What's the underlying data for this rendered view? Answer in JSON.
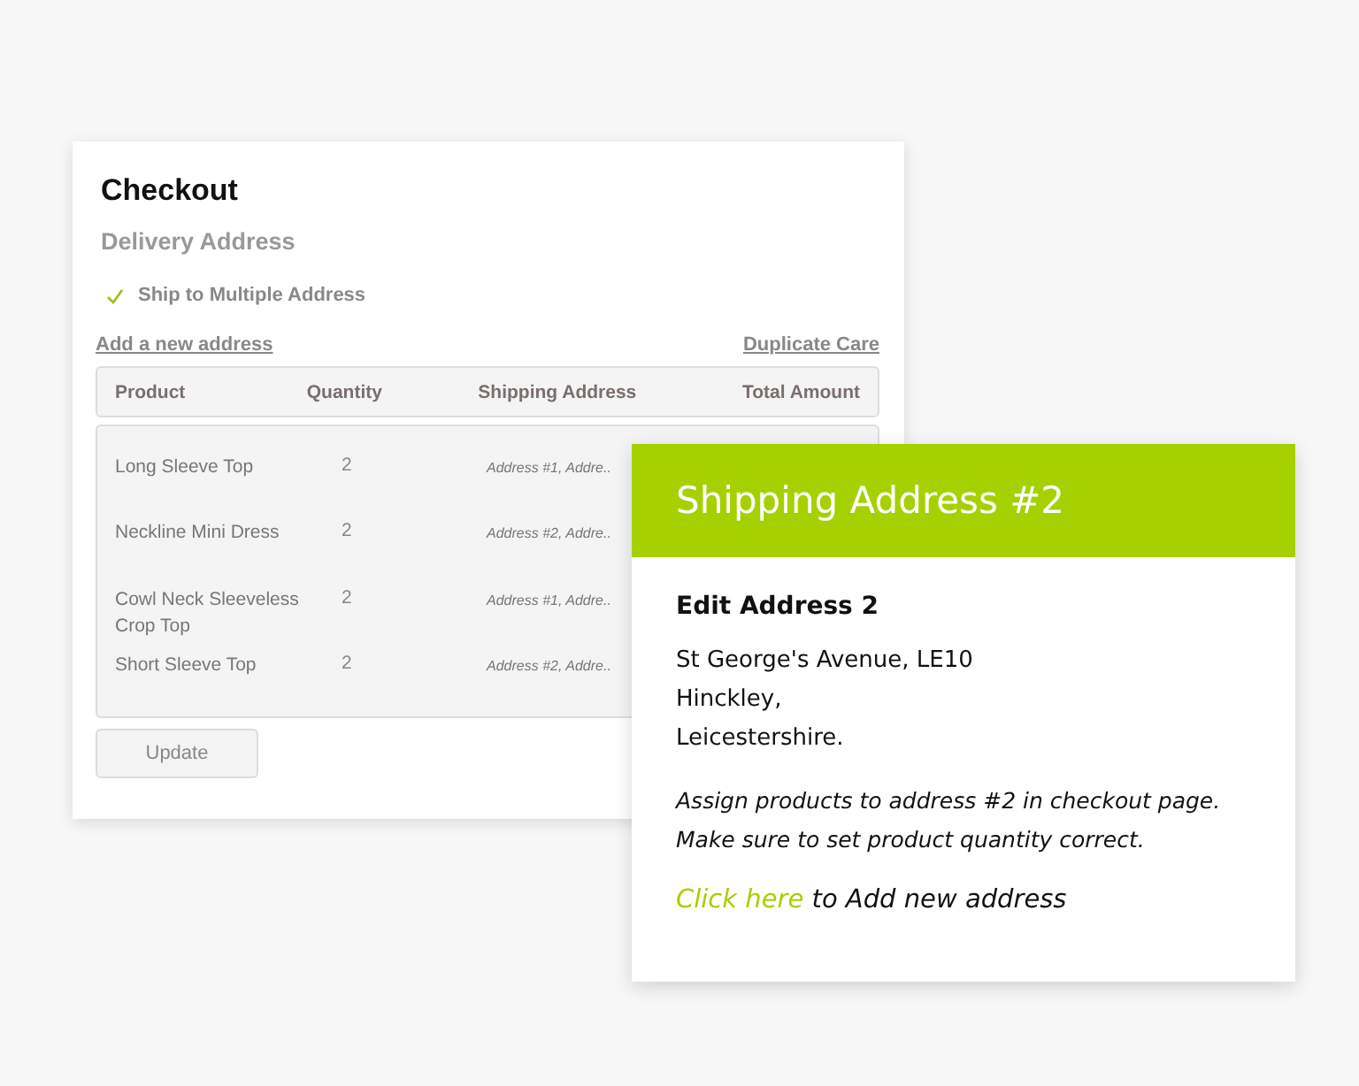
{
  "checkout": {
    "title": "Checkout",
    "subtitle": "Delivery Address",
    "ship_multiple": {
      "label": "Ship to Multiple Address",
      "checked": true
    },
    "add_address_link": "Add a new address",
    "duplicate_link": "Duplicate Care",
    "columns": [
      "Product",
      "Quantity",
      "Shipping Address",
      "Total Amount"
    ],
    "rows": [
      {
        "product": "Long Sleeve Top",
        "quantity": "2",
        "address": "Address #1, Addre.."
      },
      {
        "product": "Neckline Mini Dress",
        "quantity": "2",
        "address": "Address #2, Addre.."
      },
      {
        "product": "Cowl Neck Sleeveless Crop Top",
        "quantity": "2",
        "address": "Address #1, Addre.."
      },
      {
        "product": "Short Sleeve Top",
        "quantity": "2",
        "address": "Address #2, Addre.."
      }
    ],
    "update_button": "Update"
  },
  "popup": {
    "title": "Shipping Address #2",
    "heading": "Edit Address 2",
    "address_lines": [
      "St George's Avenue, LE10",
      "Hinckley,",
      "Leicestershire."
    ],
    "instructions": [
      "Assign products to address #2 in checkout page.",
      "Make sure to set product quantity correct."
    ],
    "link": "Click here",
    "link_rest": "to Add new address"
  }
}
